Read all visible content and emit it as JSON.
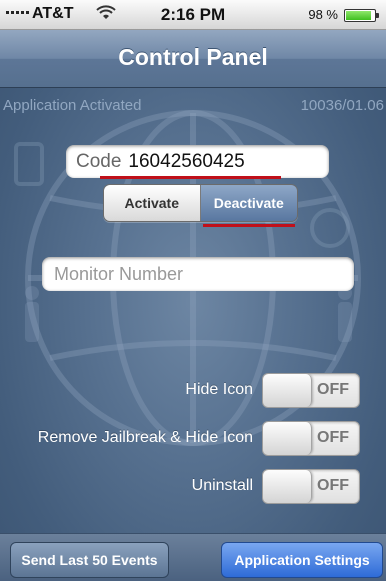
{
  "status_bar": {
    "carrier": "AT&T",
    "time": "2:16 PM",
    "battery_percent": "98 %",
    "battery_level": 0.98
  },
  "nav": {
    "title": "Control Panel"
  },
  "info": {
    "status": "Application Activated",
    "version": "10036/01.06"
  },
  "code": {
    "label": "Code",
    "value": "16042560425"
  },
  "segment": {
    "activate": "Activate",
    "deactivate": "Deactivate",
    "selected": "Deactivate"
  },
  "monitor": {
    "placeholder": "Monitor Number",
    "value": ""
  },
  "toggles": [
    {
      "label": "Hide Icon",
      "state": "OFF"
    },
    {
      "label": "Remove Jailbreak & Hide Icon",
      "state": "OFF"
    },
    {
      "label": "Uninstall",
      "state": "OFF"
    }
  ],
  "bottom": {
    "send_events": "Send Last 50 Events",
    "app_settings": "Application Settings"
  },
  "colors": {
    "accent": "#2e6bd7",
    "highlight_underline": "#c0101a",
    "nav": "#6f87a6"
  },
  "icons": [
    "signal-bars-icon",
    "wifi-icon",
    "battery-icon",
    "globe-watermark"
  ]
}
